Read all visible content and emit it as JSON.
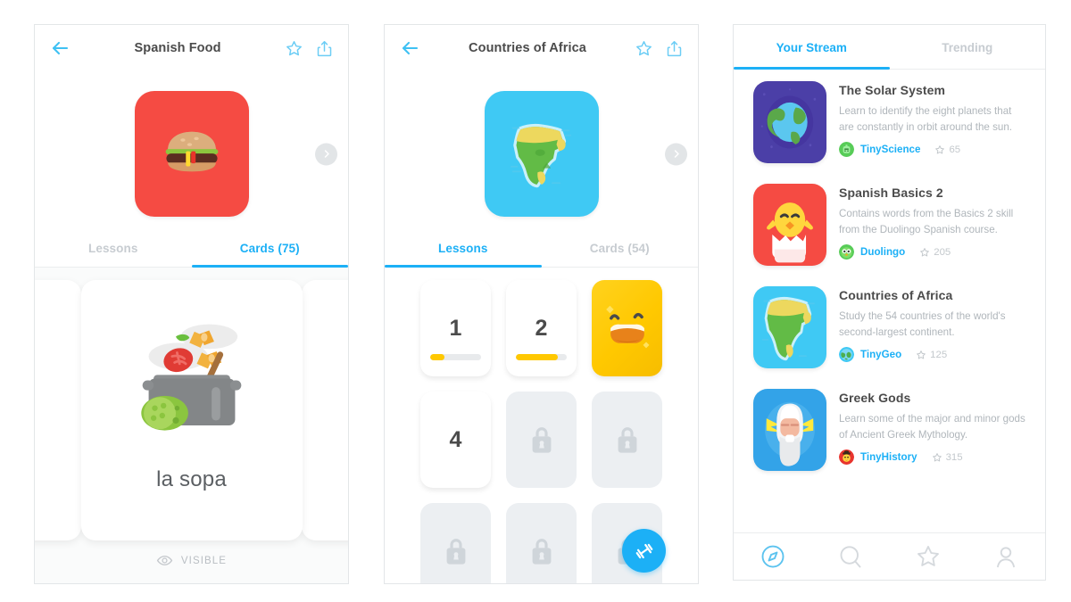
{
  "panels": {
    "deck_spanish_food": {
      "title": "Spanish Food",
      "back_icon": "back-arrow-icon",
      "star_icon": "star-outline-icon",
      "share_icon": "share-icon",
      "next_icon": "chevron-right-icon",
      "hero_icon": "hamburger-icon",
      "hero_bg": "#f54b43",
      "tabs": [
        {
          "label": "Lessons",
          "active": false
        },
        {
          "label": "Cards (75)",
          "active": true
        }
      ],
      "card": {
        "word": "la sopa",
        "image_icon": "cooking-pot-soup-icon",
        "visibility_label": "VISIBLE",
        "eye_icon": "eye-icon"
      }
    },
    "deck_countries_africa": {
      "title": "Countries of Africa",
      "back_icon": "back-arrow-icon",
      "star_icon": "star-outline-icon",
      "share_icon": "share-icon",
      "next_icon": "chevron-right-icon",
      "hero_icon": "africa-map-icon",
      "hero_bg": "#3fc9f4",
      "tabs": [
        {
          "label": "Lessons",
          "active": true
        },
        {
          "label": "Cards (54)",
          "active": false
        }
      ],
      "lessons": [
        {
          "label": "1",
          "state": "open",
          "progress": 28
        },
        {
          "label": "2",
          "state": "open",
          "progress": 82
        },
        {
          "label": "",
          "state": "gold",
          "icon": "grinning-face-icon"
        },
        {
          "label": "4",
          "state": "open",
          "progress": 0
        },
        {
          "label": "",
          "state": "locked",
          "icon": "lock-icon"
        },
        {
          "label": "",
          "state": "locked",
          "icon": "lock-icon"
        },
        {
          "label": "",
          "state": "locked",
          "icon": "lock-icon"
        },
        {
          "label": "",
          "state": "locked",
          "icon": "lock-icon"
        },
        {
          "label": "",
          "state": "locked",
          "icon": "lock-icon"
        }
      ],
      "fab_icon": "dumbbell-icon",
      "fab_color": "#1cb0f6"
    },
    "stream": {
      "tabs": [
        {
          "label": "Your Stream",
          "active": true
        },
        {
          "label": "Trending",
          "active": false
        }
      ],
      "items": [
        {
          "title": "The Solar System",
          "description": "Learn to identify the eight planets that are constantly in orbit around the sun.",
          "author": "TinyScience",
          "stars": "65",
          "thumb_icon": "earth-space-icon",
          "thumb_bg": "#4b3fa7",
          "avatar_icon": "tinyscience-avatar-icon"
        },
        {
          "title": "Spanish Basics 2",
          "description": "Contains words from the Basics 2 skill from the Duolingo Spanish course.",
          "author": "Duolingo",
          "stars": "205",
          "thumb_icon": "hatching-chick-icon",
          "thumb_bg": "#f54b43",
          "avatar_icon": "duolingo-owl-avatar-icon"
        },
        {
          "title": "Countries of Africa",
          "description": "Study the 54 countries of the world's second-largest continent.",
          "author": "TinyGeo",
          "stars": "125",
          "thumb_icon": "africa-map-icon",
          "thumb_bg": "#3fc9f4",
          "avatar_icon": "tinygeo-avatar-icon"
        },
        {
          "title": "Greek Gods",
          "description": "Learn some of the major and minor gods of Ancient Greek Mythology.",
          "author": "TinyHistory",
          "stars": "315",
          "thumb_icon": "zeus-icon",
          "thumb_bg": "#33a3e8",
          "avatar_icon": "tinyhistory-avatar-icon"
        }
      ],
      "nav": [
        {
          "name": "discover",
          "icon": "compass-icon",
          "active": true
        },
        {
          "name": "search",
          "icon": "search-icon",
          "active": false
        },
        {
          "name": "starred",
          "icon": "star-outline-icon",
          "active": false
        },
        {
          "name": "profile",
          "icon": "person-icon",
          "active": false
        }
      ]
    }
  },
  "colors": {
    "accent": "#1cb0f6",
    "muted": "#c7ccd1",
    "text": "#4b4b4b",
    "gold": "#ffc800"
  }
}
